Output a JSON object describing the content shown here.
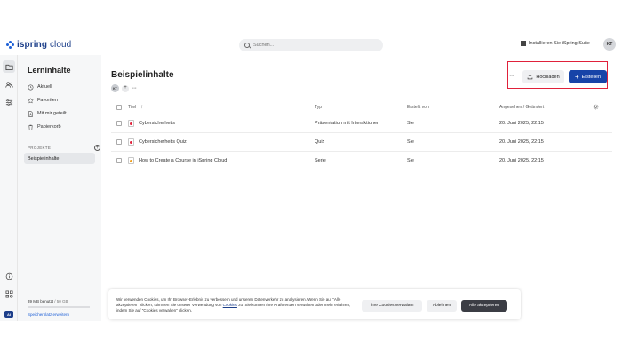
{
  "header": {
    "logo_prefix": "ispring",
    "logo_suffix": "cloud",
    "search_placeholder": "Suchen...",
    "install_label": "Installieren Sie iSpring Suite",
    "user_initials": "KT"
  },
  "rail": {
    "items": [
      "folder-icon",
      "users-icon",
      "sliders-icon"
    ],
    "bottom": [
      "help-icon",
      "apps-icon"
    ],
    "ai_label": "AI"
  },
  "sidebar": {
    "title": "Lerninhalte",
    "items": [
      {
        "label": "Aktuell",
        "icon": "clock-icon"
      },
      {
        "label": "Favoriten",
        "icon": "star-icon"
      },
      {
        "label": "Mit mir geteilt",
        "icon": "shared-icon"
      },
      {
        "label": "Papierkorb",
        "icon": "trash-icon"
      }
    ],
    "section_label": "PROJEKTE",
    "project": "Beispielinhalte",
    "storage_used": "39 MB benutzt",
    "storage_total": "/ 50 GB",
    "storage_fraction": 0.01,
    "storage_link": "Speicherplatz erweitern"
  },
  "main": {
    "title": "Beispielinhalte",
    "member_initials": "KT",
    "upload_label": "Hochladen",
    "create_label": "Erstellen",
    "columns": {
      "title": "Titel",
      "type": "Typ",
      "created_by": "Erstellt von",
      "modified": "Angesehen / Geändert"
    },
    "rows": [
      {
        "title": "Cybersicherheits",
        "type": "Präsentation mit Interaktionen",
        "created_by": "Sie",
        "modified": "20. Juni 2025, 22:15",
        "icon_color": "#e0213a"
      },
      {
        "title": "Cybersicherheits Quiz",
        "type": "Quiz",
        "created_by": "Sie",
        "modified": "20. Juni 2025, 22:15",
        "icon_color": "#e0213a"
      },
      {
        "title": "How to Create a Course in iSpring Cloud",
        "type": "Serie",
        "created_by": "Sie",
        "modified": "20. Juni 2025, 22:15",
        "icon_color": "#f0a020"
      }
    ]
  },
  "cookie": {
    "text_before_link": "Wir verwenden Cookies, um Ihr Browser-Erlebnis zu verbessern und unseren Datenverkehr zu analysieren. Wenn Sie auf \"Alle akzeptieren\" klicken, stimmen Sie unserer Verwendung von ",
    "link": "Cookies",
    "text_after_link": " zu. Sie können Ihre Präferenzen verwalten oder mehr erfahren, indem Sie auf \"Cookies verwalten\" klicken.",
    "manage_label": "Ihre Cookies verwalten",
    "decline_label": "Ablehnen",
    "accept_label": "Alle akzeptieren"
  }
}
